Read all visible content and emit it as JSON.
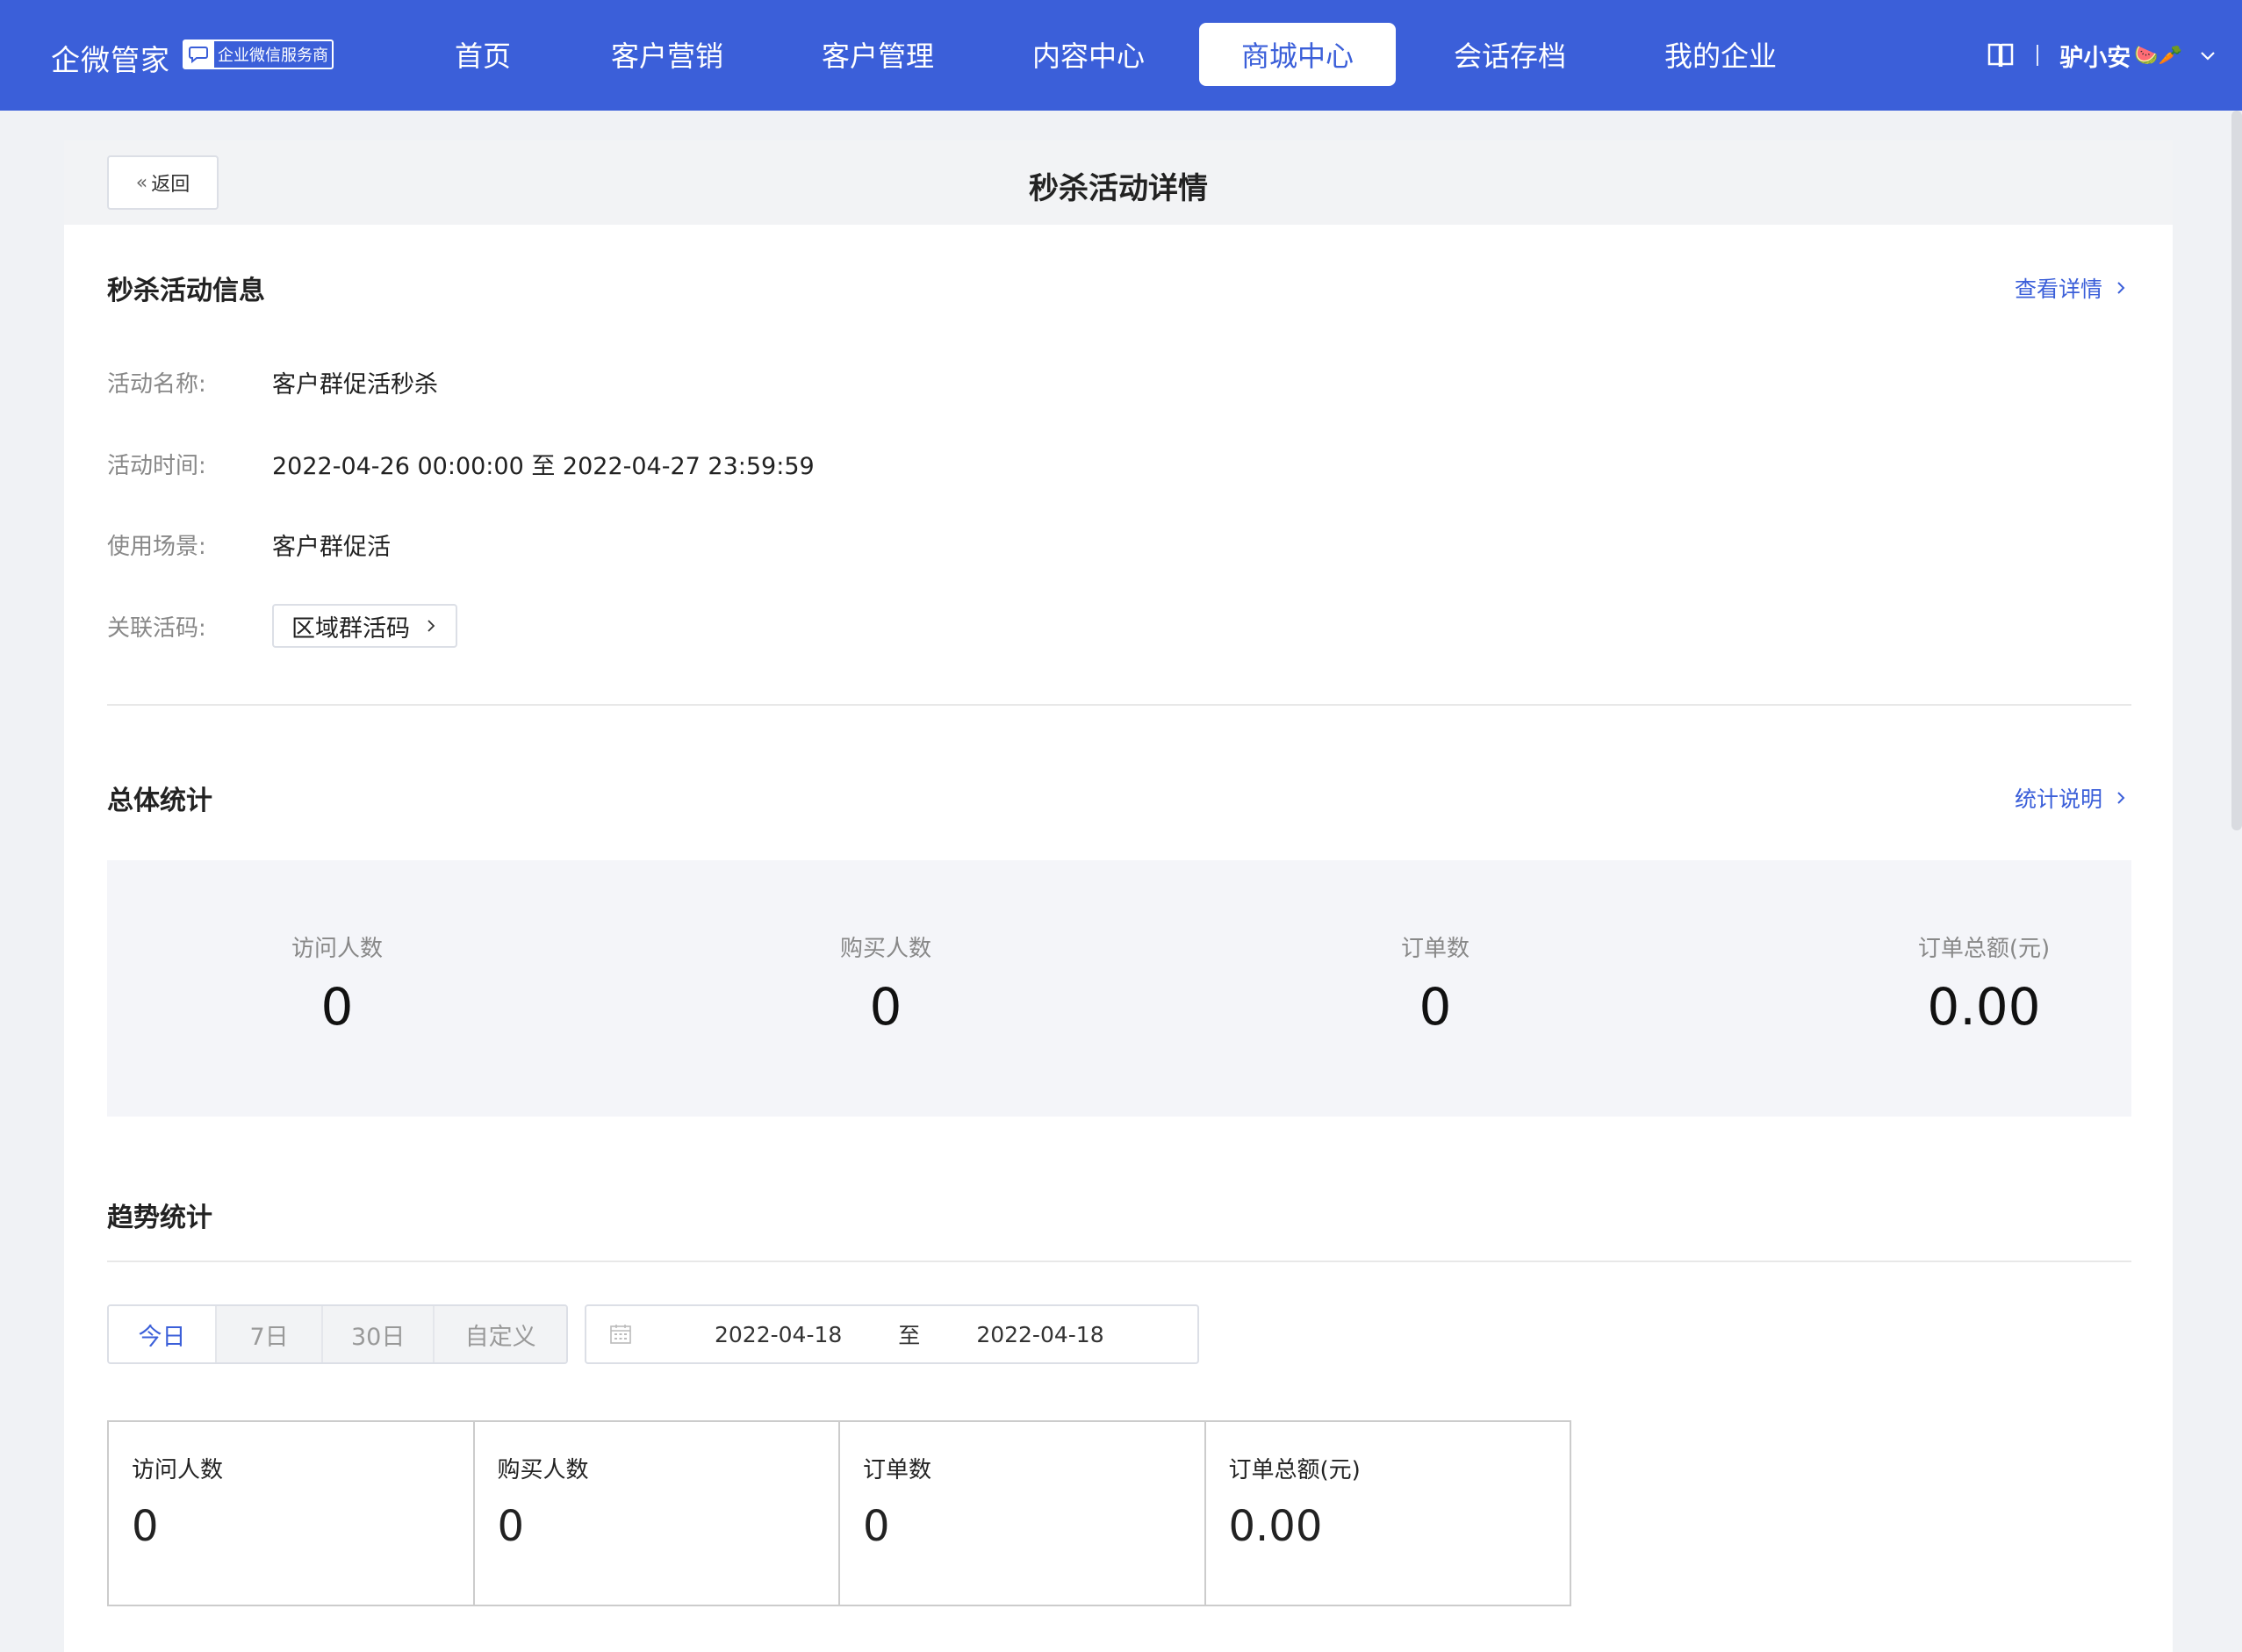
{
  "header": {
    "brand": "企微管家",
    "brand_badge": "企业微信服务商",
    "nav": [
      {
        "label": "首页"
      },
      {
        "label": "客户营销"
      },
      {
        "label": "客户管理"
      },
      {
        "label": "内容中心"
      },
      {
        "label": "商城中心",
        "active": true
      },
      {
        "label": "会话存档"
      },
      {
        "label": "我的企业"
      }
    ],
    "user_name": "驴小安",
    "user_emoji": "🍉🥕",
    "accent": "#3b5fd9"
  },
  "page": {
    "back_label": "返回",
    "title": "秒杀活动详情"
  },
  "info": {
    "section_title": "秒杀活动信息",
    "view_detail": "查看详情",
    "rows": [
      {
        "label": "活动名称:",
        "value": "客户群促活秒杀"
      },
      {
        "label": "活动时间:",
        "value": "2022-04-26 00:00:00 至 2022-04-27 23:59:59"
      },
      {
        "label": "使用场景:",
        "value": "客户群促活"
      },
      {
        "label": "关联活码:",
        "value": "区域群活码"
      }
    ]
  },
  "overall": {
    "section_title": "总体统计",
    "explain_link": "统计说明",
    "stats": [
      {
        "label": "访问人数",
        "value": "0"
      },
      {
        "label": "购买人数",
        "value": "0"
      },
      {
        "label": "订单数",
        "value": "0"
      },
      {
        "label": "订单总额(元)",
        "value": "0.00"
      }
    ]
  },
  "trend": {
    "section_title": "趋势统计",
    "ranges": [
      "今日",
      "7日",
      "30日",
      "自定义"
    ],
    "active_range": "今日",
    "date_start": "2022-04-18",
    "date_sep": "至",
    "date_end": "2022-04-18",
    "stats": [
      {
        "label": "访问人数",
        "value": "0"
      },
      {
        "label": "购买人数",
        "value": "0"
      },
      {
        "label": "订单数",
        "value": "0"
      },
      {
        "label": "订单总额(元)",
        "value": "0.00"
      }
    ]
  }
}
